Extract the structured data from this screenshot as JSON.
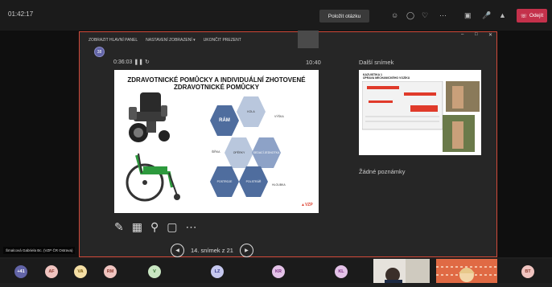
{
  "topbar": {
    "clock": "01:42:17",
    "raise_hand_label": "Položit otázku",
    "leave_label": "Odejít",
    "icons": [
      "people-icon",
      "chat-icon",
      "reactions-icon",
      "more-icon",
      "camera-icon",
      "mic-icon",
      "share-icon"
    ]
  },
  "presenter_toolbar": {
    "items": [
      "ZOBRAZIT HLAVNÍ PANEL",
      "NASTAVENÍ ZOBRAZENÍ ▾",
      "UKONČIT PREZENT"
    ]
  },
  "presenter": {
    "badge": "38",
    "elapsed": "0:36:03",
    "clock": "10:40",
    "next_label": "Další snímek",
    "notes_label": "Žádné poznámky",
    "slide_counter": "14. snímek z 21"
  },
  "slide": {
    "title_line1": "ZDRAVOTNICKÉ POMŮCKY A INDIVIDUÁLNÍ ZHOTOVENÉ",
    "title_line2": "ZDRAVOTNICKÉ POMŮCKY",
    "hexes": [
      "RÁM",
      "KOLA",
      "VÝŠKA",
      "ŠÍŘKA",
      "OPĚRKY",
      "SEDACÍ JEDNOTKA",
      "POSTROJE",
      "POLSTRÁŘ",
      "HLOUBKA"
    ],
    "logo": "VZP"
  },
  "next_slide": {
    "title_line1": "KAZUISTIKA 1",
    "title_line2": "ÚPRAVA MECHANICKÉHO VOZÍKU"
  },
  "speaker": {
    "name": "Šmalcová Gabriela Bc. (VZP ČR Ostrava)"
  },
  "participants": [
    {
      "initials": "+41",
      "color": "#6264a7",
      "text_color": "#ffffff"
    },
    {
      "initials": "AF",
      "color": "#f0c4c0",
      "text_color": "#8a3b30"
    },
    {
      "initials": "VA",
      "color": "#f5dfa5",
      "text_color": "#7a5a10"
    },
    {
      "initials": "RM",
      "color": "#f0c4c0",
      "text_color": "#8a3b30"
    },
    {
      "initials": "V",
      "color": "#c9e6c2",
      "text_color": "#2c6b28"
    },
    {
      "initials": "LZ",
      "color": "#c6c8ef",
      "text_color": "#35378a"
    },
    {
      "initials": "KR",
      "color": "#e4c2e8",
      "text_color": "#7a2e82"
    },
    {
      "initials": "KL",
      "color": "#e4c2e8",
      "text_color": "#7a2e82"
    },
    {
      "initials": "BT",
      "color": "#f0c4c0",
      "text_color": "#8a3b30"
    }
  ],
  "colors": {
    "accent_red": "#d24a3a",
    "leave_red": "#c4314b",
    "hex_dark": "#4f6d9e"
  }
}
